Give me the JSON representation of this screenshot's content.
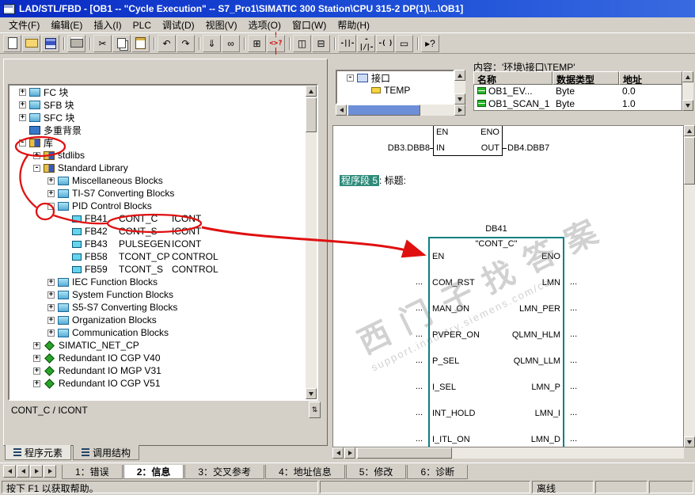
{
  "titlebar": {
    "title": "LAD/STL/FBD  -  [OB1 -- \"Cycle Execution\" -- S7_Pro1\\SIMATIC 300 Station\\CPU 315-2 DP(1)\\...\\OB1]"
  },
  "menubar": {
    "items": [
      "文件(F)",
      "编辑(E)",
      "插入(I)",
      "PLC",
      "调试(D)",
      "视图(V)",
      "选项(O)",
      "窗口(W)",
      "帮助(H)"
    ]
  },
  "toolbar": {
    "buttons": [
      {
        "name": "new",
        "kind": "page"
      },
      {
        "name": "open",
        "kind": "folder"
      },
      {
        "name": "save",
        "kind": "disk"
      },
      {
        "kind": "sep"
      },
      {
        "name": "print",
        "kind": "print"
      },
      {
        "kind": "sep"
      },
      {
        "name": "cut",
        "glyph": "✂"
      },
      {
        "name": "copy",
        "kind": "copy"
      },
      {
        "name": "paste",
        "kind": "clip"
      },
      {
        "kind": "sep"
      },
      {
        "name": "undo",
        "glyph": "↶"
      },
      {
        "name": "redo",
        "glyph": "↷"
      },
      {
        "kind": "sep"
      },
      {
        "name": "download",
        "glyph": "⇓"
      },
      {
        "name": "monitor",
        "glyph": "∞"
      },
      {
        "kind": "sep"
      },
      {
        "name": "program-elements",
        "glyph": "⊞"
      },
      {
        "name": "status-word",
        "glyph": "!<>?|",
        "cls": "accent"
      },
      {
        "kind": "sep"
      },
      {
        "name": "split-source",
        "glyph": "◫"
      },
      {
        "name": "split-detail",
        "glyph": "⊟"
      },
      {
        "kind": "sep"
      },
      {
        "name": "contact-no",
        "glyph": "-||-",
        "cls": "lad"
      },
      {
        "name": "contact-nc",
        "glyph": "-|/|-",
        "cls": "lad"
      },
      {
        "name": "coil",
        "glyph": "-( )",
        "cls": "lad"
      },
      {
        "name": "empty-box",
        "glyph": "▭"
      },
      {
        "kind": "sep"
      },
      {
        "name": "help",
        "glyph": "▸?"
      }
    ]
  },
  "tree": {
    "items": [
      {
        "exp": "+",
        "icon": "folder",
        "label": "FC 块",
        "level": 0
      },
      {
        "exp": "+",
        "icon": "folder",
        "label": "SFB 块",
        "level": 0
      },
      {
        "exp": "+",
        "icon": "folder",
        "label": "SFC 块",
        "level": 0
      },
      {
        "exp": "",
        "icon": "multi",
        "label": "多重背景",
        "level": 0
      },
      {
        "exp": "-",
        "icon": "lib",
        "label": "库",
        "level": 0
      },
      {
        "exp": "+",
        "icon": "lib",
        "label": "stdlibs",
        "level": 1
      },
      {
        "exp": "-",
        "icon": "lib",
        "label": "Standard Library",
        "level": 1
      },
      {
        "exp": "+",
        "icon": "folder",
        "label": "Miscellaneous Blocks",
        "level": 2
      },
      {
        "exp": "+",
        "icon": "folder",
        "label": "TI-S7 Converting Blocks",
        "level": 2
      },
      {
        "exp": "-",
        "icon": "folder",
        "label": "PID Control Blocks",
        "level": 2
      },
      {
        "exp": "",
        "icon": "fb",
        "label": "FB41",
        "c2": "CONT_C",
        "c3": "ICONT",
        "level": 3
      },
      {
        "exp": "",
        "icon": "fb",
        "label": "FB42",
        "c2": "CONT_S",
        "c3": "ICONT",
        "level": 3
      },
      {
        "exp": "",
        "icon": "fb",
        "label": "FB43",
        "c2": "PULSEGEN",
        "c3": "ICONT",
        "level": 3
      },
      {
        "exp": "",
        "icon": "fb",
        "label": "FB58",
        "c2": "TCONT_CP",
        "c3": "CONTROL",
        "level": 3
      },
      {
        "exp": "",
        "icon": "fb",
        "label": "FB59",
        "c2": "TCONT_S",
        "c3": "CONTROL",
        "level": 3
      },
      {
        "exp": "+",
        "icon": "folder",
        "label": "IEC Function Blocks",
        "level": 2
      },
      {
        "exp": "+",
        "icon": "folder",
        "label": "System Function Blocks",
        "level": 2
      },
      {
        "exp": "+",
        "icon": "folder",
        "label": "S5-S7 Converting Blocks",
        "level": 2
      },
      {
        "exp": "+",
        "icon": "folder",
        "label": "Organization Blocks",
        "level": 2
      },
      {
        "exp": "+",
        "icon": "folder",
        "label": "Communication Blocks",
        "level": 2
      },
      {
        "exp": "+",
        "icon": "green",
        "label": "SIMATIC_NET_CP",
        "level": 1
      },
      {
        "exp": "+",
        "icon": "green",
        "label": "Redundant IO CGP V40",
        "level": 1
      },
      {
        "exp": "+",
        "icon": "green",
        "label": "Redundant IO MGP V31",
        "level": 1
      },
      {
        "exp": "+",
        "icon": "green",
        "label": "Redundant IO CGP V51",
        "level": 1
      }
    ]
  },
  "panel": {
    "status": "CONT_C / ICONT",
    "tabs": [
      {
        "label": "程序元素",
        "active": true
      },
      {
        "label": "调用结构"
      }
    ]
  },
  "iface": {
    "content_label": "内容：'环境\\接口\\TEMP'",
    "tree": [
      {
        "exp": "-",
        "icon": "iface",
        "label": "接口",
        "level": 0
      },
      {
        "exp": "",
        "icon": "vartemp",
        "label": "TEMP",
        "level": 1
      }
    ],
    "columns": [
      "名称",
      "数据类型",
      "地址"
    ],
    "rows": [
      {
        "name": "OB1_EV...",
        "type": "Byte",
        "addr": "0.0"
      },
      {
        "name": "OB1_SCAN_1",
        "type": "Byte",
        "addr": "1.0"
      }
    ]
  },
  "ladder": {
    "move": {
      "pin_tl": "EN",
      "pin_tr": "ENO",
      "pin_bl": "IN",
      "pin_br": "OUT",
      "left_operand": "DB3.DBB8",
      "right_operand": "DB4.DBB7"
    },
    "network": {
      "number_label": "程序段 5",
      "title_suffix": ": 标题:"
    },
    "block": {
      "db_label": "DB41",
      "name": "\"CONT_C\"",
      "pins": [
        {
          "l": "EN",
          "r": "ENO",
          "lo": "",
          "ro": ""
        },
        {
          "l": "COM_RST",
          "r": "LMN",
          "lo": "...",
          "ro": "..."
        },
        {
          "l": "MAN_ON",
          "r": "LMN_PER",
          "lo": "...",
          "ro": "..."
        },
        {
          "l": "PVPER_ON",
          "r": "QLMN_HLM",
          "lo": "...",
          "ro": "..."
        },
        {
          "l": "P_SEL",
          "r": "QLMN_LLM",
          "lo": "...",
          "ro": "..."
        },
        {
          "l": "I_SEL",
          "r": "LMN_P",
          "lo": "...",
          "ro": "..."
        },
        {
          "l": "INT_HOLD",
          "r": "LMN_I",
          "lo": "...",
          "ro": "..."
        },
        {
          "l": "I_ITL_ON",
          "r": "LMN_D",
          "lo": "...",
          "ro": "..."
        }
      ]
    }
  },
  "bottom": {
    "tabs": [
      {
        "label": "1：错误"
      },
      {
        "label": "2：信息",
        "active": true
      },
      {
        "label": "3：交叉参考"
      },
      {
        "label": "4：地址信息"
      },
      {
        "label": "5：修改"
      },
      {
        "label": "6：诊断"
      }
    ]
  },
  "statusbar": {
    "help": "按下 F1 以获取帮助。",
    "mode": "离线"
  },
  "watermark": {
    "text": "西门子找答案",
    "url": "support.industry.siemens.com/cs"
  },
  "colors": {
    "accent_blue": "#1e50d8",
    "block_border": "#0a8080",
    "annotation_red": "#e01010",
    "highlight_green": "#2e8b7a"
  }
}
